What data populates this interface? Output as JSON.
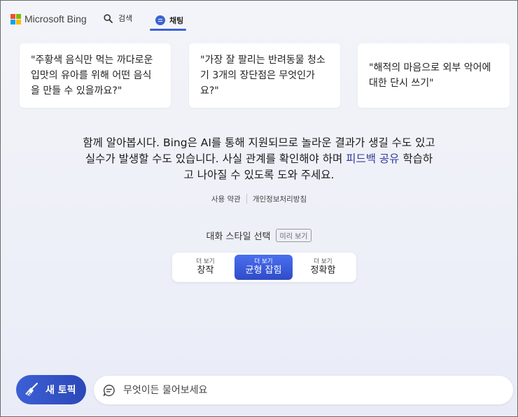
{
  "header": {
    "logo_text": "Microsoft Bing",
    "nav_search_label": "검색",
    "nav_chat_label": "채팅",
    "accent_color": "#3c62d4"
  },
  "cards": [
    {
      "line1": "\"주황색 음식만 먹는 까다로운",
      "line2": "입맛의 유아를 위해 어떤 음식",
      "line3": "을 만들 수 있을까요?\""
    },
    {
      "line1": "\"가장 잘 팔리는 반려동물 청소",
      "line2": "기 3개의 장단점은 무엇인가",
      "line3": "요?\""
    },
    {
      "line1": "\"해적의 마음으로 외부 악어에",
      "line2": "대한 단시 쓰기\""
    }
  ],
  "disclaimer": {
    "line1": "함께 알아봅시다. Bing은 AI를 통해 지원되므로 놀라운 결과가 생길 수도 있고",
    "line2_before": "실수가 발생할 수도 있습니다. 사실 관계를 확인해야 하며 ",
    "line2_link": "피드백 공유",
    "line2_after": " 학습하",
    "line3": "고 나아질 수 있도록 도와 주세요."
  },
  "legal": {
    "terms": "사용 약관",
    "privacy": "개인정보처리방침"
  },
  "style_selector": {
    "title": "대화 스타일 선택",
    "preview_badge": "미리 보기",
    "options": [
      {
        "small": "더 보기",
        "label": "창작",
        "selected": false
      },
      {
        "small": "더 보기",
        "label": "균형 잡힘",
        "selected": true
      },
      {
        "small": "더 보기",
        "label": "정확함",
        "selected": false
      }
    ]
  },
  "bottom": {
    "new_topic_label": "새 토픽",
    "input_placeholder": "무엇이든 물어보세요"
  }
}
